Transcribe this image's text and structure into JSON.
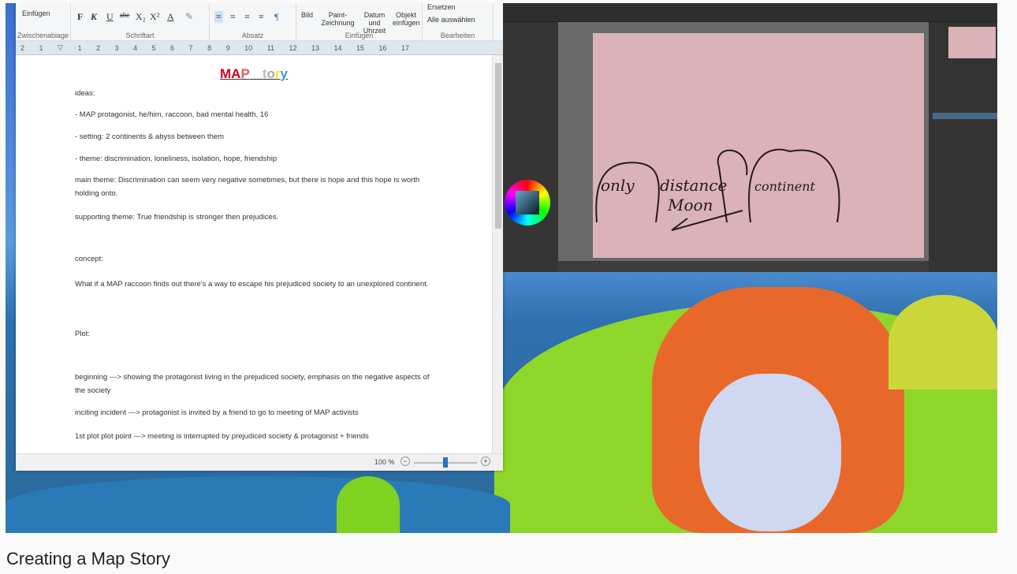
{
  "word": {
    "ribbon": {
      "clipboard": {
        "paste": "Einfügen",
        "label": "Zwischenablage"
      },
      "font": {
        "bold": "F",
        "italic": "K",
        "underline": "U",
        "strike": "abc",
        "sub": "X₂",
        "sup": "X²",
        "color": "A",
        "label": "Schriftart"
      },
      "paragraph": {
        "label": "Absatz"
      },
      "insert": {
        "picture": "Bild",
        "paint": "Paint-Zeichnung",
        "datetime": "Datum und Uhrzeit",
        "object": "Objekt einfügen",
        "label": "Einfügen"
      },
      "edit": {
        "replace": "Ersetzen",
        "select_all": "Alle auswählen",
        "label": "Bearbeiten"
      }
    },
    "ruler": [
      "2",
      "1",
      "",
      "1",
      "2",
      "3",
      "4",
      "5",
      "6",
      "7",
      "8",
      "9",
      "10",
      "11",
      "12",
      "13",
      "14",
      "15",
      "16",
      "17"
    ],
    "doc": {
      "title": "MAP Story",
      "lines": [
        "ideas:",
        "- MAP protagonist,  he/him,  raccoon, bad mental health, 16",
        "- setting:  2 continents & abyss between them",
        "- theme:  discrimination,  loneliness,  isolation, hope, friendship",
        "main theme: Discrimination  can seem very negative sometimes,  but there is hope and this hope is worth holding onto.",
        "supporting  theme:  True  friendship  is stronger  then prejudices.",
        "concept:",
        "What if a MAP raccoon finds out there's a way to escape his prejudiced  society to an unexplored  continent.",
        "Plot:",
        "beginning  ---> showing the protagonist  living in the prejudiced  society,  emphasis  on the negative aspects of the society",
        "inciting incident  ---> protagonist is invited by a friend to go to meeting  of MAP activists",
        "1st plot plot point  ---> meeting is interrupted  by prejudiced  society & protagonist  + friends"
      ]
    },
    "status": {
      "zoom": "100 %",
      "zoom_level": 100
    }
  },
  "paint": {
    "canvas_color": "#d9b3b8",
    "sketch_words": [
      "only",
      "distance",
      "continent",
      "Moon"
    ]
  },
  "caption": "Creating a Map Story"
}
